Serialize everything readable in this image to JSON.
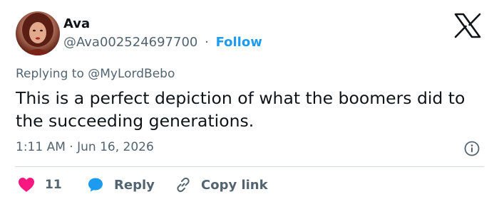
{
  "author": {
    "name": "Ava",
    "handle": "@Ava002524697700",
    "separator": "·",
    "follow_label": "Follow"
  },
  "reply_context": {
    "prefix": "Replying to",
    "handle": "@MyLordBebo"
  },
  "tweet": {
    "text": "This is a perfect depiction of what the boomers did to the succeeding generations.",
    "time": "1:11 AM",
    "separator": "·",
    "date": "Jun 16, 2026"
  },
  "actions": {
    "like_count": "11",
    "reply_label": "Reply",
    "copy_link_label": "Copy link"
  },
  "colors": {
    "accent": "#1d9bf0",
    "like": "#f91880",
    "muted": "#536471",
    "text": "#0f1419",
    "divider": "#cfd9de"
  },
  "icons": [
    "x-logo-icon",
    "info-icon",
    "heart-icon",
    "speech-bubble-icon",
    "link-icon"
  ]
}
